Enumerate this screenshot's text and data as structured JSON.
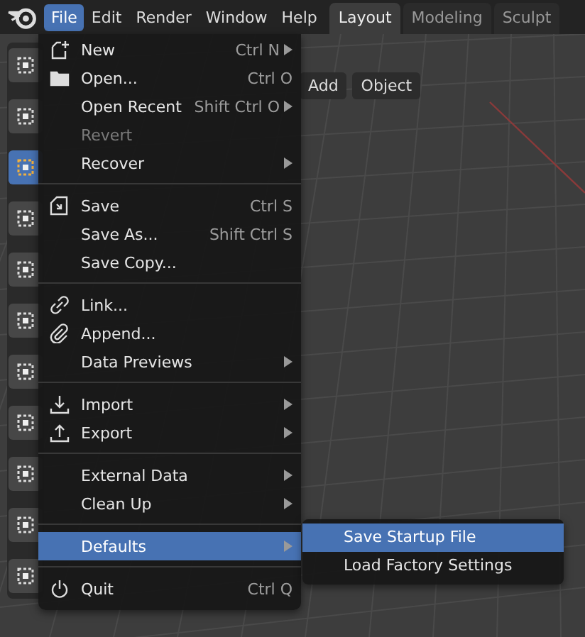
{
  "menubar": [
    {
      "label": "File",
      "selected": true
    },
    {
      "label": "Edit",
      "selected": false
    },
    {
      "label": "Render",
      "selected": false
    },
    {
      "label": "Window",
      "selected": false
    },
    {
      "label": "Help",
      "selected": false
    }
  ],
  "workspace_tabs": [
    {
      "label": "Layout",
      "selected": true
    },
    {
      "label": "Modeling",
      "selected": false
    },
    {
      "label": "Sculpt",
      "selected": false
    }
  ],
  "viewport_header": [
    "Add",
    "Object"
  ],
  "toolbar": [
    {
      "selected": false
    },
    {
      "selected": false
    },
    {
      "selected": true
    },
    {
      "selected": false
    },
    {
      "selected": false
    },
    {
      "selected": false
    },
    {
      "selected": false
    },
    {
      "selected": false
    },
    {
      "selected": false
    },
    {
      "selected": false
    },
    {
      "selected": false
    }
  ],
  "file_menu": [
    [
      {
        "label": "New",
        "shortcut": "Ctrl N",
        "submenu": true,
        "disabled": false,
        "selected": false
      },
      {
        "label": "Open...",
        "shortcut": "Ctrl O",
        "submenu": false,
        "disabled": false,
        "selected": false
      },
      {
        "label": "Open Recent",
        "shortcut": "Shift Ctrl O",
        "submenu": true,
        "disabled": false,
        "selected": false
      },
      {
        "label": "Revert",
        "submenu": false,
        "disabled": true,
        "selected": false
      },
      {
        "label": "Recover",
        "submenu": true,
        "disabled": false,
        "selected": false
      }
    ],
    [
      {
        "label": "Save",
        "shortcut": "Ctrl S",
        "submenu": false,
        "disabled": false,
        "selected": false
      },
      {
        "label": "Save As...",
        "shortcut": "Shift Ctrl S",
        "submenu": false,
        "disabled": false,
        "selected": false
      },
      {
        "label": "Save Copy...",
        "submenu": false,
        "disabled": false,
        "selected": false
      }
    ],
    [
      {
        "label": "Link...",
        "submenu": false,
        "disabled": false,
        "selected": false
      },
      {
        "label": "Append...",
        "submenu": false,
        "disabled": false,
        "selected": false
      },
      {
        "label": "Data Previews",
        "submenu": true,
        "disabled": false,
        "selected": false
      }
    ],
    [
      {
        "label": "Import",
        "submenu": true,
        "disabled": false,
        "selected": false
      },
      {
        "label": "Export",
        "submenu": true,
        "disabled": false,
        "selected": false
      }
    ],
    [
      {
        "label": "External Data",
        "submenu": true,
        "disabled": false,
        "selected": false
      },
      {
        "label": "Clean Up",
        "submenu": true,
        "disabled": false,
        "selected": false
      }
    ],
    [
      {
        "label": "Defaults",
        "submenu": true,
        "disabled": false,
        "selected": true
      }
    ],
    [
      {
        "label": "Quit",
        "shortcut": "Ctrl Q",
        "submenu": false,
        "disabled": false,
        "selected": false
      }
    ]
  ],
  "defaults_submenu": [
    {
      "label": "Save Startup File",
      "selected": true
    },
    {
      "label": "Load Factory Settings",
      "selected": false
    }
  ]
}
